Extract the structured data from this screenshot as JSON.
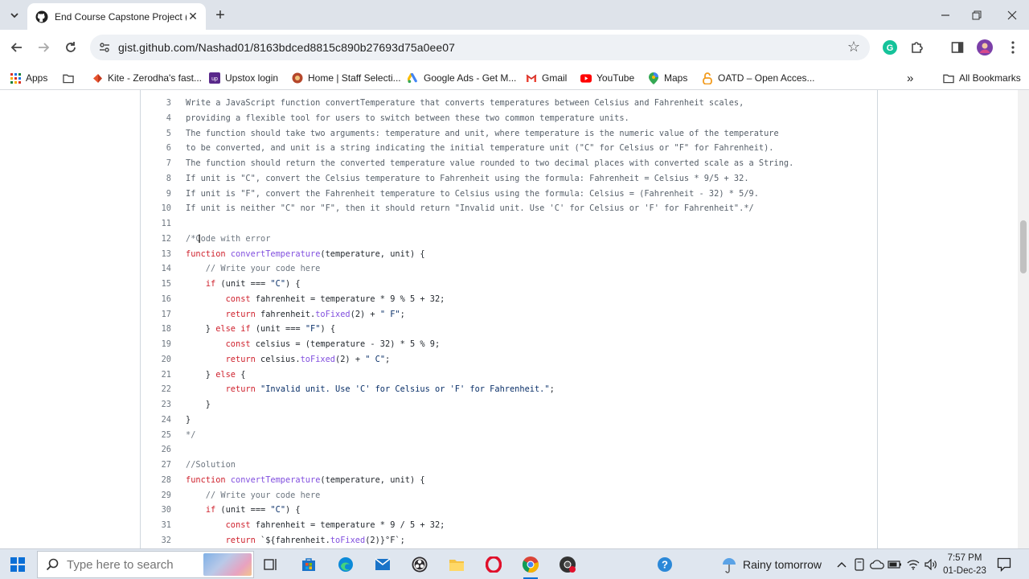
{
  "browser": {
    "tab_title": "End Course Capstone Project (N",
    "url": "gist.github.com/Nashad01/8163bdced8815c890b27693d75a0ee07"
  },
  "bookmarks": [
    {
      "label": "Apps",
      "icon": "apps-grid-icon"
    },
    {
      "label": "",
      "icon": "folder-icon"
    },
    {
      "label": "Kite - Zerodha's fast...",
      "icon": "kite-icon"
    },
    {
      "label": "Upstox login",
      "icon": "upstox-icon"
    },
    {
      "label": "Home | Staff Selecti...",
      "icon": "ssc-icon"
    },
    {
      "label": "Google Ads - Get M...",
      "icon": "google-ads-icon"
    },
    {
      "label": "Gmail",
      "icon": "gmail-icon"
    },
    {
      "label": "YouTube",
      "icon": "youtube-icon"
    },
    {
      "label": "Maps",
      "icon": "maps-icon"
    },
    {
      "label": "OATD – Open Acces...",
      "icon": "oatd-icon"
    }
  ],
  "all_bookmarks_label": "All Bookmarks",
  "code": [
    {
      "n": "3",
      "t": "Write a JavaScript function convertTemperature that converts temperatures between Celsius and Fahrenheit scales,"
    },
    {
      "n": "4",
      "t": "providing a flexible tool for users to switch between these two common temperature units."
    },
    {
      "n": "5",
      "t": "The function should take two arguments: temperature and unit, where temperature is the numeric value of the temperature"
    },
    {
      "n": "6",
      "t": "to be converted, and unit is a string indicating the initial temperature unit (\"C\" for Celsius or \"F\" for Fahrenheit)."
    },
    {
      "n": "7",
      "t": "The function should return the converted temperature value rounded to two decimal places with converted scale as a String."
    },
    {
      "n": "8",
      "t": "If unit is \"C\", convert the Celsius temperature to Fahrenheit using the formula: Fahrenheit = Celsius * 9/5 + 32."
    },
    {
      "n": "9",
      "t": "If unit is \"F\", convert the Fahrenheit temperature to Celsius using the formula: Celsius = (Fahrenheit - 32) * 5/9."
    },
    {
      "n": "10",
      "t": "If unit is neither \"C\" nor \"F\", then it should return \"Invalid unit. Use 'C' for Celsius or 'F' for Fahrenheit\".*/"
    },
    {
      "n": "11",
      "t": ""
    },
    {
      "n": "12",
      "t": "/*Code with error"
    },
    {
      "n": "13",
      "t": "function convertTemperature(temperature, unit) {"
    },
    {
      "n": "14",
      "t": "    // Write your code here"
    },
    {
      "n": "15",
      "t": "    if (unit === \"C\") {"
    },
    {
      "n": "16",
      "t": "        const fahrenheit = temperature * 9 % 5 + 32;"
    },
    {
      "n": "17",
      "t": "        return fahrenheit.toFixed(2) + \" F\";"
    },
    {
      "n": "18",
      "t": "    } else if (unit === \"F\") {"
    },
    {
      "n": "19",
      "t": "        const celsius = (temperature - 32) * 5 % 9;"
    },
    {
      "n": "20",
      "t": "        return celsius.toFixed(2) + \" C\";"
    },
    {
      "n": "21",
      "t": "    } else {"
    },
    {
      "n": "22",
      "t": "        return \"Invalid unit. Use 'C' for Celsius or 'F' for Fahrenheit.\";"
    },
    {
      "n": "23",
      "t": "    }"
    },
    {
      "n": "24",
      "t": "}"
    },
    {
      "n": "25",
      "t": "*/"
    },
    {
      "n": "26",
      "t": ""
    },
    {
      "n": "27",
      "t": "//Solution"
    },
    {
      "n": "28",
      "t": "function convertTemperature(temperature, unit) {"
    },
    {
      "n": "29",
      "t": "    // Write your code here"
    },
    {
      "n": "30",
      "t": "    if (unit === \"C\") {"
    },
    {
      "n": "31",
      "t": "        const fahrenheit = temperature * 9 / 5 + 32;"
    },
    {
      "n": "32",
      "t": "        return `${fahrenheit.toFixed(2)}°F`;"
    }
  ],
  "taskbar": {
    "search_placeholder": "Type here to search",
    "weather": "Rainy tomorrow",
    "time": "7:57 PM",
    "date": "01-Dec-23"
  },
  "colors": {
    "accent": "#0b6fd6",
    "keyword": "#cf222e",
    "function_name": "#8250df",
    "string": "#0a3069",
    "comment": "#6e7781"
  }
}
